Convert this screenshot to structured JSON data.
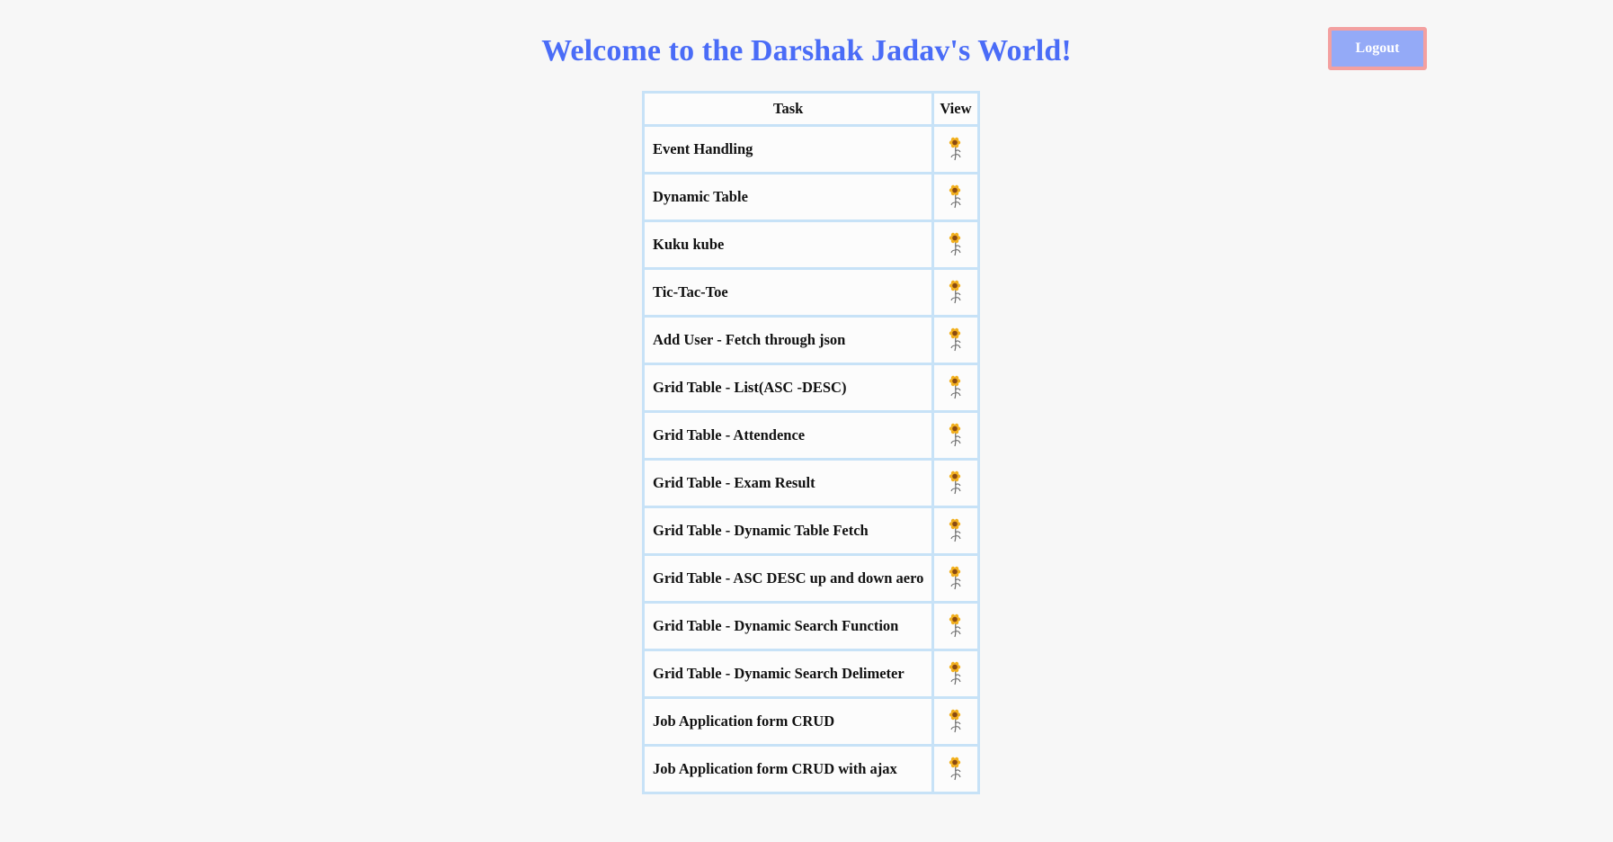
{
  "header": {
    "title": "Welcome to the Darshak Jadav's World!",
    "logout_label": "Logout"
  },
  "table": {
    "headers": [
      "Task",
      "View"
    ],
    "rows": [
      {
        "task": "Event Handling",
        "view_icon": "sunflower-icon"
      },
      {
        "task": "Dynamic Table",
        "view_icon": "sunflower-icon"
      },
      {
        "task": "Kuku kube",
        "view_icon": "sunflower-icon"
      },
      {
        "task": "Tic-Tac-Toe",
        "view_icon": "sunflower-icon"
      },
      {
        "task": "Add User - Fetch through json",
        "view_icon": "sunflower-icon"
      },
      {
        "task": "Grid Table - List(ASC -DESC)",
        "view_icon": "sunflower-icon"
      },
      {
        "task": "Grid Table - Attendence",
        "view_icon": "sunflower-icon"
      },
      {
        "task": "Grid Table - Exam Result",
        "view_icon": "sunflower-icon"
      },
      {
        "task": "Grid Table - Dynamic Table Fetch",
        "view_icon": "sunflower-icon"
      },
      {
        "task": "Grid Table - ASC DESC up and down aero",
        "view_icon": "sunflower-icon"
      },
      {
        "task": "Grid Table - Dynamic Search Function",
        "view_icon": "sunflower-icon"
      },
      {
        "task": "Grid Table - Dynamic Search Delimeter",
        "view_icon": "sunflower-icon"
      },
      {
        "task": "Job Application form CRUD",
        "view_icon": "sunflower-icon"
      },
      {
        "task": "Job Application form CRUD with ajax",
        "view_icon": "sunflower-icon"
      }
    ]
  },
  "colors": {
    "title": "#4a6cf7",
    "logout_bg": "#94aaf7",
    "logout_border": "#f3a0a0",
    "table_border": "#c7e2f7",
    "page_bg": "#f7f7f7"
  }
}
